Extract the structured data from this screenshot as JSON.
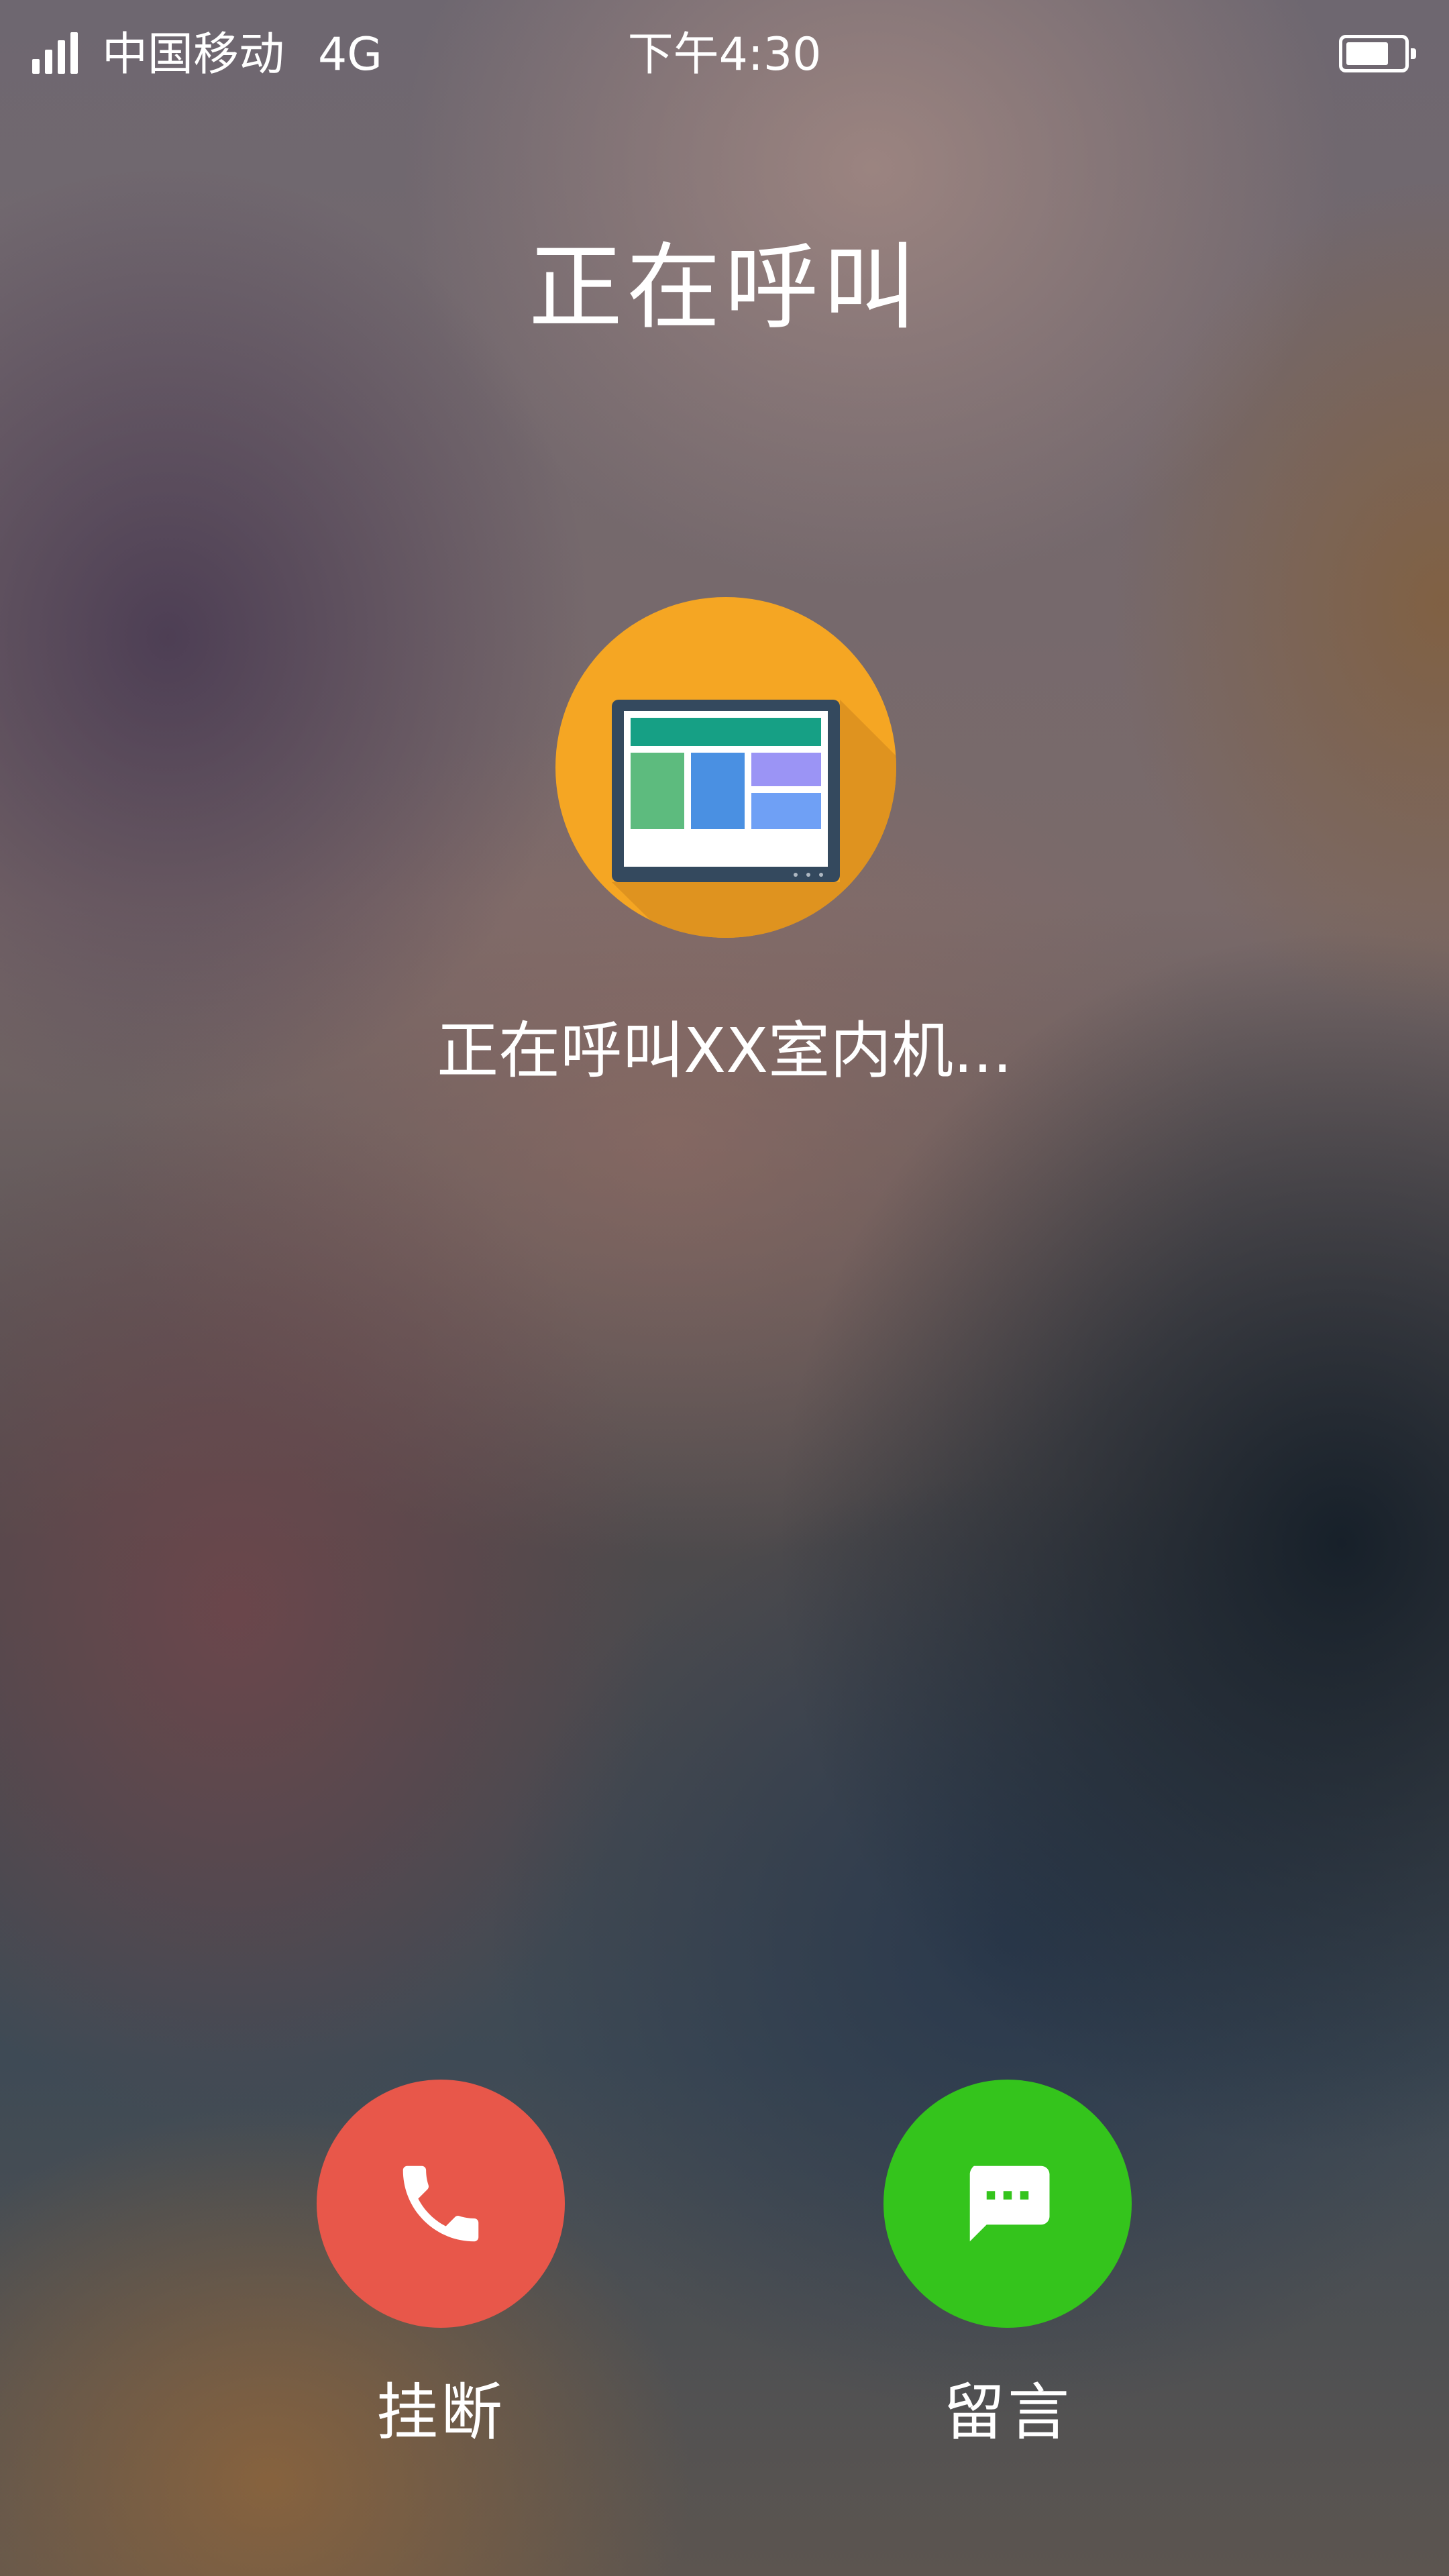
{
  "status_bar": {
    "carrier": "中国移动",
    "network": "4G",
    "time": "下午4:30",
    "battery_level": 0.75
  },
  "title": "正在呼叫",
  "callee": {
    "icon": "indoor-unit-screen-icon",
    "calling_text": "正在呼叫XX室内机..."
  },
  "actions": {
    "hangup": {
      "label": "挂断",
      "icon": "phone-icon",
      "color": "#E8574A"
    },
    "message": {
      "label": "留言",
      "icon": "chat-bubble-icon",
      "color": "#34C41C"
    }
  },
  "colors": {
    "icon_circle": "#F5A623",
    "screen_frame": "#34495E",
    "screen_header": "#16A085"
  }
}
